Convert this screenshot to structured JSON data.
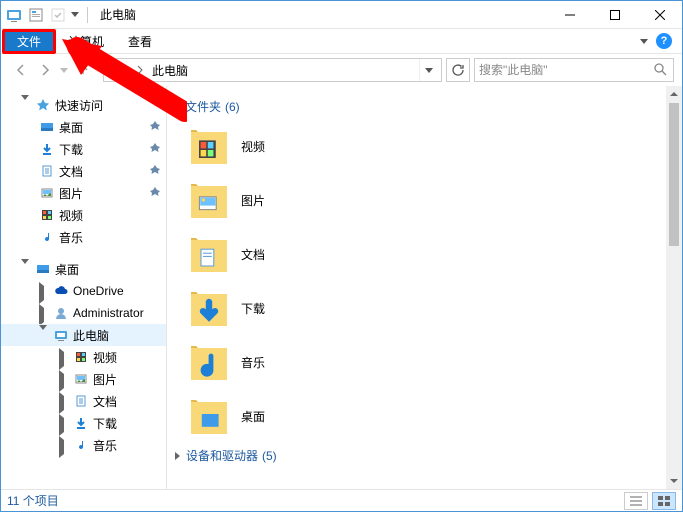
{
  "title": "此电脑",
  "ribbon": {
    "file": "文件",
    "computer": "计算机",
    "view": "查看"
  },
  "address": {
    "current": "此电脑"
  },
  "search": {
    "placeholder": "搜索\"此电脑\""
  },
  "sidebar": {
    "quick": "快速访问",
    "quick_items": [
      {
        "label": "桌面",
        "icon": "desktop"
      },
      {
        "label": "下载",
        "icon": "download"
      },
      {
        "label": "文档",
        "icon": "doc"
      },
      {
        "label": "图片",
        "icon": "pic"
      },
      {
        "label": "视频",
        "icon": "video"
      },
      {
        "label": "音乐",
        "icon": "music"
      }
    ],
    "desktop_root": "桌面",
    "onedrive": "OneDrive",
    "admin": "Administrator",
    "thispc": "此电脑",
    "pc_items": [
      {
        "label": "视频",
        "icon": "video"
      },
      {
        "label": "图片",
        "icon": "pic"
      },
      {
        "label": "文档",
        "icon": "doc"
      },
      {
        "label": "下载",
        "icon": "download"
      },
      {
        "label": "音乐",
        "icon": "music"
      }
    ]
  },
  "content": {
    "group_folders": "文件夹",
    "folder_count": "(6)",
    "folders": [
      {
        "label": "视频",
        "icon": "video"
      },
      {
        "label": "图片",
        "icon": "pic"
      },
      {
        "label": "文档",
        "icon": "doc"
      },
      {
        "label": "下载",
        "icon": "download"
      },
      {
        "label": "音乐",
        "icon": "music"
      },
      {
        "label": "桌面",
        "icon": "desktop"
      }
    ],
    "group_drives": "设备和驱动器",
    "drive_count": "(5)"
  },
  "status": {
    "count": "11 个项目"
  }
}
